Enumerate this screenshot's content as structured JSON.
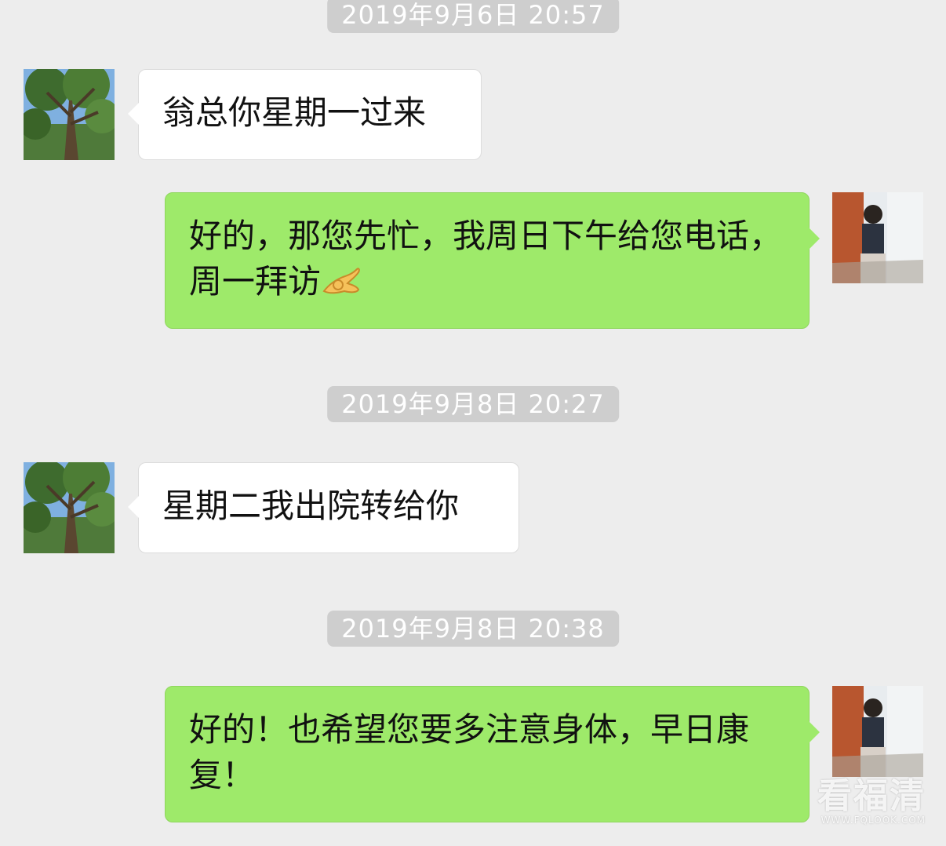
{
  "chat": {
    "messages": [
      {
        "type": "timestamp",
        "text": "2019年9月6日 20:57"
      },
      {
        "type": "incoming",
        "text": "翁总你星期一过来"
      },
      {
        "type": "outgoing",
        "text": "好的，那您先忙，我周日下午给您电话，周一拜访",
        "emoji": "ok-hand-emoji"
      },
      {
        "type": "timestamp",
        "text": "2019年9月8日 20:27"
      },
      {
        "type": "incoming",
        "text": "星期二我出院转给你"
      },
      {
        "type": "timestamp",
        "text": "2019年9月8日 20:38"
      },
      {
        "type": "outgoing",
        "text": "好的！也希望您要多注意身体，早日康复！"
      }
    ]
  },
  "watermark": {
    "main": "看福清",
    "sub": "WWW.FQLOOK.COM"
  },
  "colors": {
    "background": "#ededed",
    "outgoing_bubble": "#9eea6a",
    "incoming_bubble": "#ffffff",
    "timestamp_bg": "#cecece"
  }
}
